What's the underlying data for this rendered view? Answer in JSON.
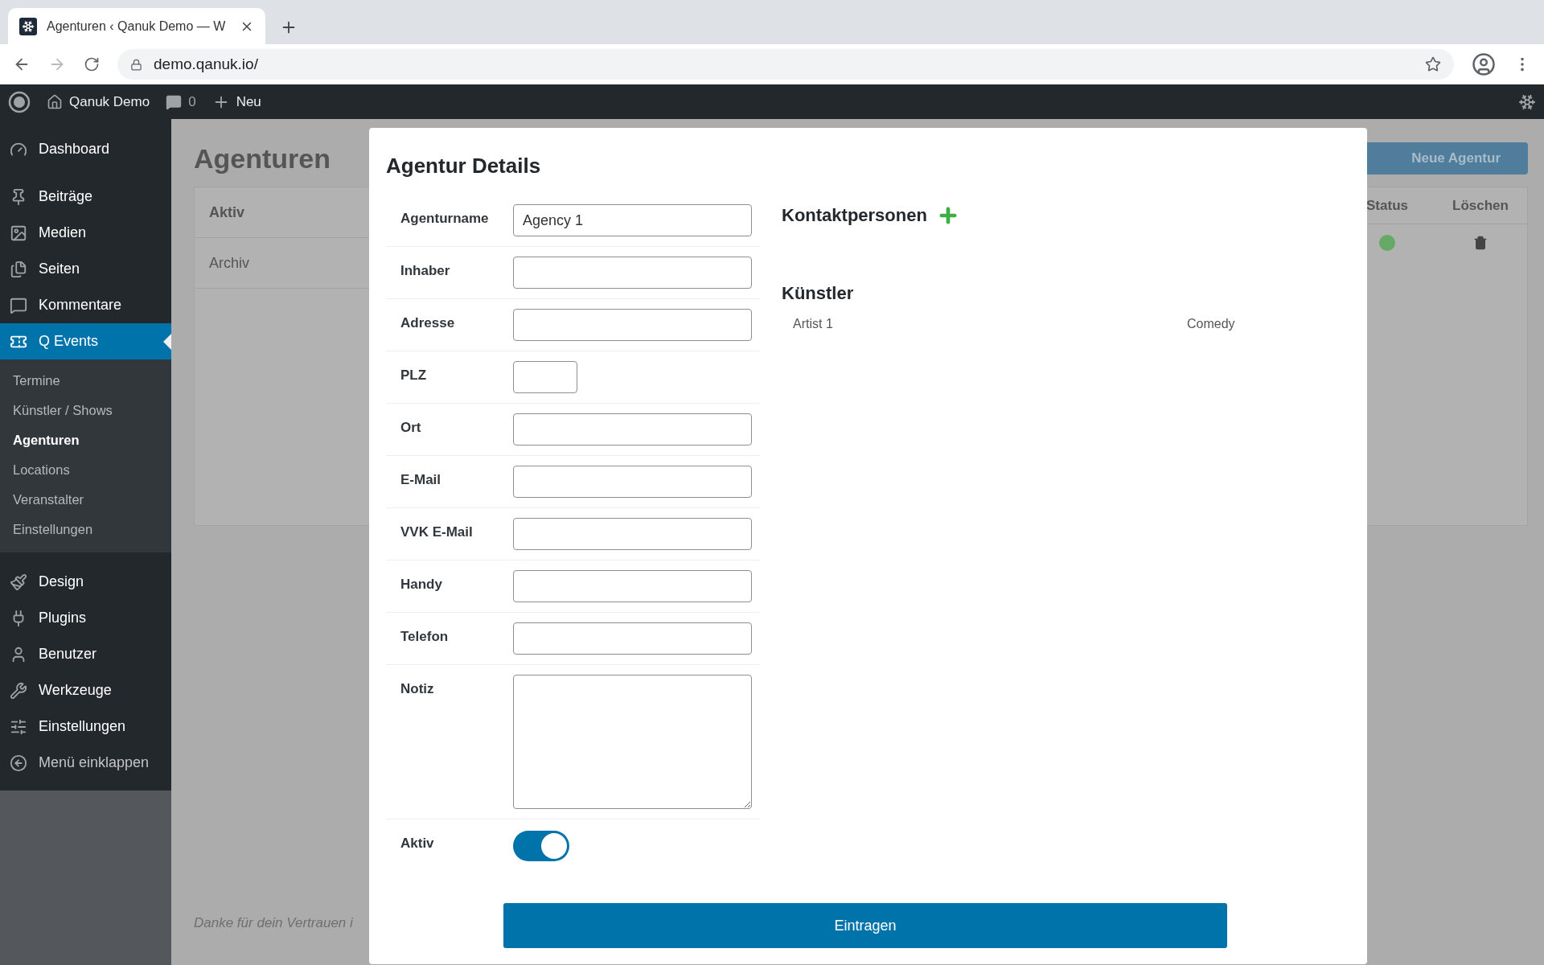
{
  "browser": {
    "tab_title": "Agenturen ‹ Qanuk Demo — W",
    "url": "demo.qanuk.io/"
  },
  "admin_bar": {
    "site": "Qanuk Demo",
    "comments": "0",
    "new": "Neu"
  },
  "sidebar": {
    "items": [
      {
        "label": "Dashboard",
        "selected": false
      },
      {
        "label": "Beiträge",
        "selected": false
      },
      {
        "label": "Medien",
        "selected": false
      },
      {
        "label": "Seiten",
        "selected": false
      },
      {
        "label": "Kommentare",
        "selected": false
      },
      {
        "label": "Q Events",
        "selected": true,
        "children": [
          {
            "label": "Termine",
            "selected": false
          },
          {
            "label": "Künstler / Shows",
            "selected": false
          },
          {
            "label": "Agenturen",
            "selected": true
          },
          {
            "label": "Locations",
            "selected": false
          },
          {
            "label": "Veranstalter",
            "selected": false
          },
          {
            "label": "Einstellungen",
            "selected": false
          }
        ]
      },
      {
        "label": "Design",
        "selected": false
      },
      {
        "label": "Plugins",
        "selected": false
      },
      {
        "label": "Benutzer",
        "selected": false
      },
      {
        "label": "Werkzeuge",
        "selected": false
      },
      {
        "label": "Einstellungen",
        "selected": false
      },
      {
        "label": "Menü einklappen",
        "selected": false
      }
    ]
  },
  "page": {
    "title": "Agenturen",
    "new_button": "Neue Agentur",
    "tabs": [
      {
        "label": "Aktiv",
        "selected": true
      },
      {
        "label": "Archiv",
        "selected": false
      }
    ],
    "columns": [
      "Status",
      "Löschen"
    ],
    "rows": [
      {
        "color": "#66a866"
      }
    ],
    "footer": "Danke für dein Vertrauen i"
  },
  "modal": {
    "title": "Agentur Details",
    "fields": [
      {
        "label": "Agenturname",
        "kind": "text",
        "value": "Agency 1"
      },
      {
        "label": "Inhaber",
        "kind": "text"
      },
      {
        "label": "Adresse",
        "kind": "text"
      },
      {
        "label": "PLZ",
        "kind": "short"
      },
      {
        "label": "Ort",
        "kind": "text"
      },
      {
        "label": "E-Mail",
        "kind": "text"
      },
      {
        "label": "VVK E-Mail",
        "kind": "text"
      },
      {
        "label": "Handy",
        "kind": "text"
      },
      {
        "label": "Telefon",
        "kind": "text"
      },
      {
        "label": "Notiz",
        "kind": "textarea"
      },
      {
        "label": "Aktiv",
        "kind": "toggle",
        "on": true
      }
    ],
    "contacts_title": "Kontaktpersonen",
    "artists_title": "Künstler",
    "artists": [
      {
        "name": "Artist 1",
        "genre": "Comedy"
      }
    ],
    "submit": "Eintragen"
  }
}
